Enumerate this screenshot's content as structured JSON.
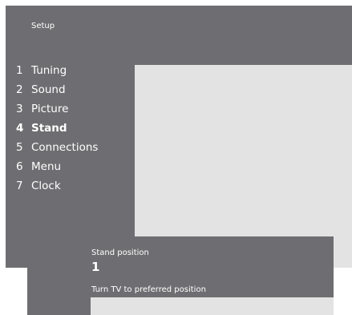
{
  "window": {
    "title": "Setup"
  },
  "menu": {
    "items": [
      {
        "number": "1",
        "label": "Tuning",
        "active": false
      },
      {
        "number": "2",
        "label": "Sound",
        "active": false
      },
      {
        "number": "3",
        "label": "Picture",
        "active": false
      },
      {
        "number": "4",
        "label": "Stand",
        "active": true
      },
      {
        "number": "5",
        "label": "Connections",
        "active": false
      },
      {
        "number": "6",
        "label": "Menu",
        "active": false
      },
      {
        "number": "7",
        "label": "Clock",
        "active": false
      }
    ]
  },
  "popup": {
    "label": "Stand position",
    "value": "1",
    "hint": "Turn TV to preferred position"
  },
  "colors": {
    "panel_background": "#6e6e72",
    "content_background": "#e3e3e3",
    "text": "#ffffff"
  }
}
